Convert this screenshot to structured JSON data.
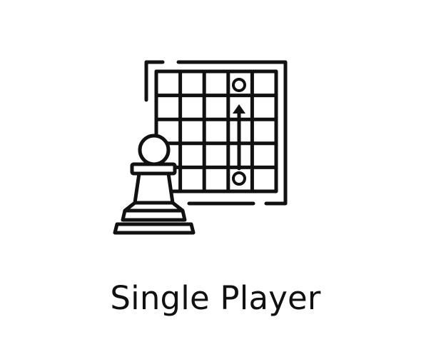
{
  "mode": {
    "label": "Single Player",
    "icon": "chess-board-pawn-icon"
  },
  "colors": {
    "background": "#ffffff",
    "icon_stroke": "#111111",
    "label_text": "#111111"
  }
}
